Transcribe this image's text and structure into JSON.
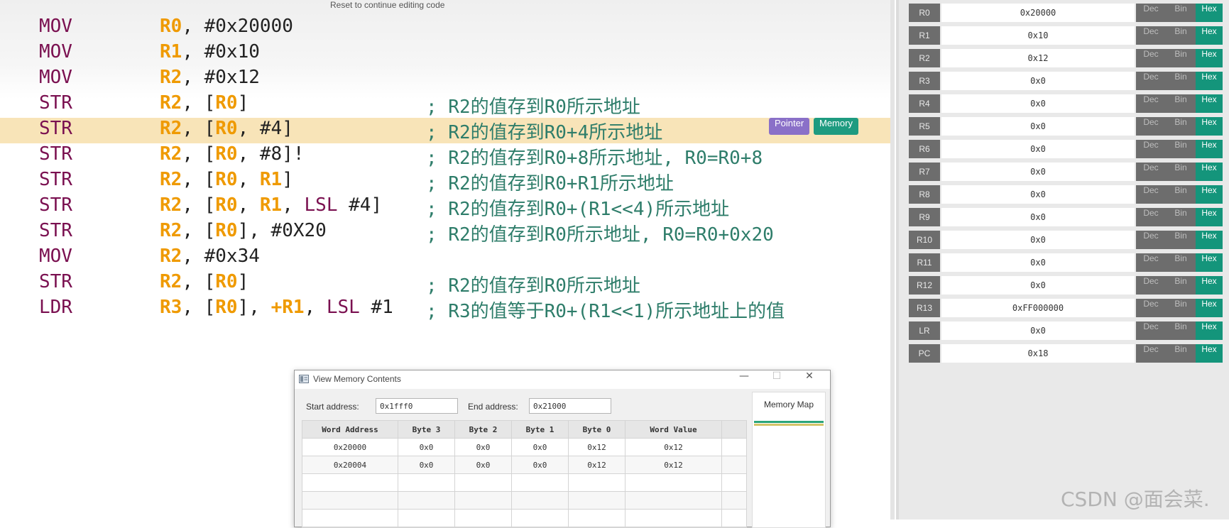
{
  "editor": {
    "reset_hint": "Reset to continue editing code",
    "lines": [
      {
        "op": "MOV",
        "args": [
          [
            "reg",
            "R0"
          ],
          [
            "txt",
            ", #0x20000"
          ]
        ],
        "comment": ""
      },
      {
        "op": "MOV",
        "args": [
          [
            "reg",
            "R1"
          ],
          [
            "txt",
            ", #0x10"
          ]
        ],
        "comment": ""
      },
      {
        "op": "MOV",
        "args": [
          [
            "reg",
            "R2"
          ],
          [
            "txt",
            ", #0x12"
          ]
        ],
        "comment": ""
      },
      {
        "op": "STR",
        "args": [
          [
            "reg",
            "R2"
          ],
          [
            "txt",
            ", ["
          ],
          [
            "reg",
            "R0"
          ],
          [
            "txt",
            "]"
          ]
        ],
        "comment": "; R2的值存到R0所示地址"
      },
      {
        "op": "STR",
        "args": [
          [
            "reg",
            "R2"
          ],
          [
            "txt",
            ", ["
          ],
          [
            "reg",
            "R0"
          ],
          [
            "txt",
            ", #4]"
          ]
        ],
        "comment": "; R2的值存到R0+4所示地址"
      },
      {
        "op": "STR",
        "args": [
          [
            "reg",
            "R2"
          ],
          [
            "txt",
            ", ["
          ],
          [
            "reg",
            "R0"
          ],
          [
            "txt",
            ", #8]!"
          ]
        ],
        "comment": "; R2的值存到R0+8所示地址, R0=R0+8"
      },
      {
        "op": "STR",
        "args": [
          [
            "reg",
            "R2"
          ],
          [
            "txt",
            ", ["
          ],
          [
            "reg",
            "R0"
          ],
          [
            "txt",
            ", "
          ],
          [
            "reg",
            "R1"
          ],
          [
            "txt",
            "]"
          ]
        ],
        "comment": "; R2的值存到R0+R1所示地址"
      },
      {
        "op": "STR",
        "args": [
          [
            "reg",
            "R2"
          ],
          [
            "txt",
            ", ["
          ],
          [
            "reg",
            "R0"
          ],
          [
            "txt",
            ", "
          ],
          [
            "reg",
            "R1"
          ],
          [
            "txt",
            ", "
          ],
          [
            "kw",
            "LSL"
          ],
          [
            "txt",
            " #4]"
          ]
        ],
        "comment": "; R2的值存到R0+(R1<<4)所示地址"
      },
      {
        "op": "STR",
        "args": [
          [
            "reg",
            "R2"
          ],
          [
            "txt",
            ", ["
          ],
          [
            "reg",
            "R0"
          ],
          [
            "txt",
            "], #0X20"
          ]
        ],
        "comment": "; R2的值存到R0所示地址, R0=R0+0x20"
      },
      {
        "op": "MOV",
        "args": [
          [
            "reg",
            "R2"
          ],
          [
            "txt",
            ", #0x34"
          ]
        ],
        "comment": ""
      },
      {
        "op": "STR",
        "args": [
          [
            "reg",
            "R2"
          ],
          [
            "txt",
            ", ["
          ],
          [
            "reg",
            "R0"
          ],
          [
            "txt",
            "]"
          ]
        ],
        "comment": "; R2的值存到R0所示地址"
      },
      {
        "op": "LDR",
        "args": [
          [
            "reg",
            "R3"
          ],
          [
            "txt",
            ", ["
          ],
          [
            "reg",
            "R0"
          ],
          [
            "txt",
            "], "
          ],
          [
            "reg",
            "+R1"
          ],
          [
            "txt",
            ", "
          ],
          [
            "kw",
            "LSL"
          ],
          [
            "txt",
            " #1"
          ]
        ],
        "comment": "; R3的值等于R0+(R1<<1)所示地址上的值"
      }
    ],
    "current_line": 4,
    "pointer_label": "Pointer",
    "memory_label": "Memory"
  },
  "registers": [
    {
      "name": "R0",
      "value": "0x20000"
    },
    {
      "name": "R1",
      "value": "0x10"
    },
    {
      "name": "R2",
      "value": "0x12"
    },
    {
      "name": "R3",
      "value": "0x0"
    },
    {
      "name": "R4",
      "value": "0x0"
    },
    {
      "name": "R5",
      "value": "0x0"
    },
    {
      "name": "R6",
      "value": "0x0"
    },
    {
      "name": "R7",
      "value": "0x0"
    },
    {
      "name": "R8",
      "value": "0x0"
    },
    {
      "name": "R9",
      "value": "0x0"
    },
    {
      "name": "R10",
      "value": "0x0"
    },
    {
      "name": "R11",
      "value": "0x0"
    },
    {
      "name": "R12",
      "value": "0x0"
    },
    {
      "name": "R13",
      "value": "0xFF000000"
    },
    {
      "name": "LR",
      "value": "0x0"
    },
    {
      "name": "PC",
      "value": "0x18"
    }
  ],
  "register_buttons": {
    "dec": "Dec",
    "bin": "Bin",
    "hex": "Hex"
  },
  "memory_dialog": {
    "title": "View Memory Contents",
    "start_label": "Start address:",
    "start_value": "0x1fff0",
    "end_label": "End address:",
    "end_value": "0x21000",
    "columns": [
      "Word Address",
      "Byte 3",
      "Byte 2",
      "Byte 1",
      "Byte 0",
      "Word Value"
    ],
    "rows": [
      [
        "0x20000",
        "0x0",
        "0x0",
        "0x0",
        "0x12",
        "0x12"
      ],
      [
        "0x20004",
        "0x0",
        "0x0",
        "0x0",
        "0x12",
        "0x12"
      ]
    ],
    "map_title": "Memory Map"
  },
  "watermark": "CSDN @面会菜."
}
